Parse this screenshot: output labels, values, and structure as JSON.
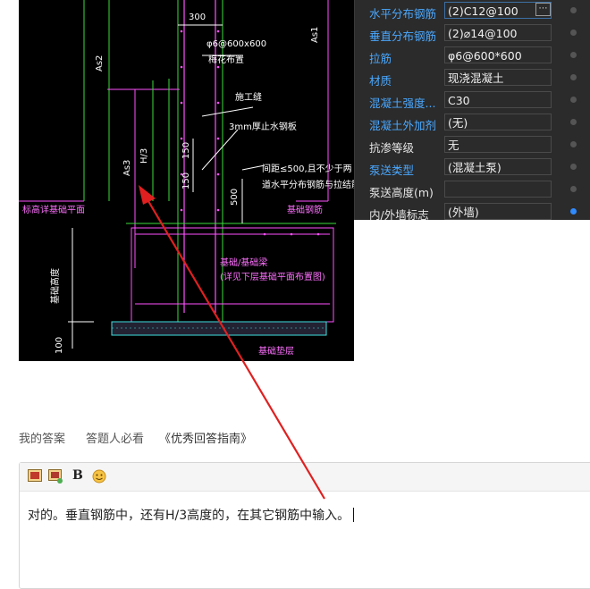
{
  "cad": {
    "labels": {
      "dim_300": "300",
      "dim_150a": "150",
      "dim_150b": "150",
      "dim_500": "500",
      "dim_100": "100",
      "h3": "H/3",
      "as1": "As1",
      "as2": "As2",
      "as3": "As3",
      "tie_spec": "φ6@600x600",
      "tie_note": "梅花布置",
      "construction_joint": "施工缝",
      "steel_plate": "3mm厚止水钢板",
      "spacing_note_1": "间距≤500,且不少于两",
      "spacing_note_2": "道水平分布钢筋与拉结筋",
      "foundation_rebar": "基础钢筋",
      "foundation_mark": "标高详基础平面",
      "beam_note_1": "基础/基础梁",
      "beam_note_2": "(详见下层基础平面布置图)",
      "foundation_height": "基础高度",
      "cushion_note": "基础垫层"
    }
  },
  "properties": [
    {
      "key": "水平分布钢筋",
      "value": "(2)C12@100",
      "blue": true,
      "has_button": true,
      "button": "⋯",
      "selected": true
    },
    {
      "key": "垂直分布钢筋",
      "value": "(2)⌀14@100",
      "blue": true
    },
    {
      "key": "拉筋",
      "value": "φ6@600*600",
      "blue": true
    },
    {
      "key": "材质",
      "value": "现浇混凝土",
      "blue": true
    },
    {
      "key": "混凝土强度...",
      "value": "C30",
      "blue": true
    },
    {
      "key": "混凝土外加剂",
      "value": "(无)",
      "blue": true
    },
    {
      "key": "抗渗等级",
      "value": "无",
      "blue": false
    },
    {
      "key": "泵送类型",
      "value": "(混凝土泵)",
      "blue": true
    },
    {
      "key": "泵送高度(m)",
      "value": "",
      "blue": false
    },
    {
      "key": "内/外墙标志",
      "value": "(外墙)",
      "blue": false,
      "active": true
    }
  ],
  "tabs": {
    "my_answer": "我的答案",
    "must_read": "答题人必看",
    "guide": "《优秀回答指南》"
  },
  "editor": {
    "bold_label": "B",
    "text": "对的。垂直钢筋中，还有H/3高度的，在其它钢筋中输入。"
  },
  "colors": {
    "arrow": "#e02020",
    "panel_bg": "#2b2b2b",
    "key_blue": "#4aa8ff",
    "cad_bg": "#000000"
  }
}
